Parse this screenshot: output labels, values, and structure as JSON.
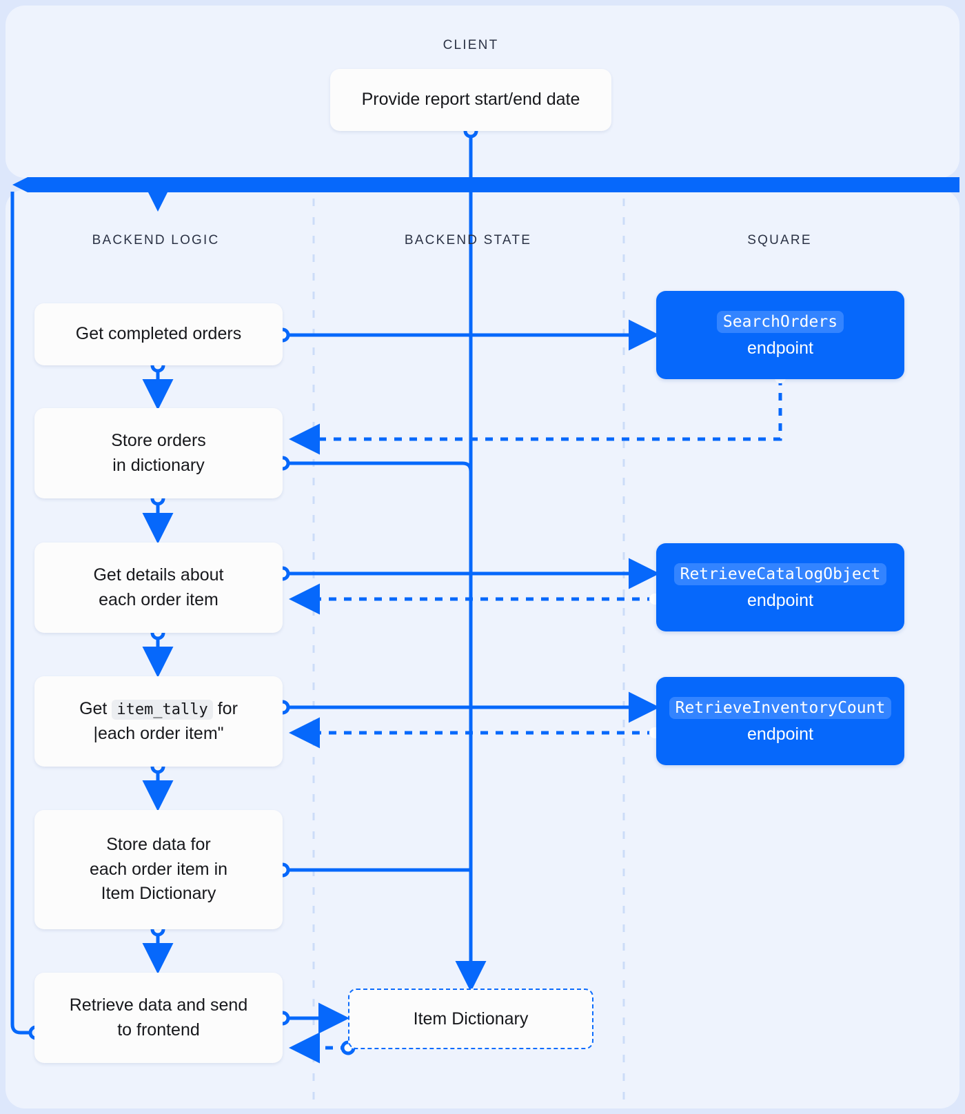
{
  "diagram": {
    "title": "Square order report backend sequence diagram",
    "colors": {
      "accent": "#0668fb",
      "accent_chip": "#3384ff",
      "panel_bg": "#eef3fd",
      "page_bg": "#dde7fb",
      "node_bg": "#fcfcfc",
      "band_dark": "#0668fb",
      "band_light": "#cddefb",
      "lane_divider": "#ccdcf8",
      "text": "#17181c",
      "lane_label": "#2b3245"
    },
    "lanes": [
      {
        "id": "client",
        "label": "CLIENT"
      },
      {
        "id": "backend-logic",
        "label": "BACKEND LOGIC"
      },
      {
        "id": "backend-state",
        "label": "BACKEND STATE"
      },
      {
        "id": "square",
        "label": "SQUARE"
      }
    ],
    "client_nodes": [
      {
        "id": "provide-dates",
        "label": "Provide report start/end date"
      }
    ],
    "backend_logic_nodes": [
      {
        "id": "get-completed-orders",
        "lines": [
          "Get completed orders"
        ]
      },
      {
        "id": "store-orders",
        "lines": [
          "Store orders",
          "in dictionary"
        ]
      },
      {
        "id": "get-item-details",
        "lines": [
          "Get details about",
          "each order item"
        ]
      },
      {
        "id": "get-item-tally",
        "lines": [
          "Get ",
          " for",
          "|each order item\""
        ],
        "prefix": "Get",
        "code": "item_tally",
        "suffix": "for",
        "line2": "|each order item\""
      },
      {
        "id": "store-item-data",
        "lines": [
          "Store data for",
          "each order item in",
          "Item Dictionary"
        ]
      },
      {
        "id": "retrieve-send",
        "lines": [
          "Retrieve data and send",
          "to frontend"
        ]
      }
    ],
    "backend_state_nodes": [
      {
        "id": "item-dictionary",
        "label": "Item Dictionary"
      }
    ],
    "square_nodes": [
      {
        "id": "search-orders",
        "code": "SearchOrders",
        "sub": "endpoint"
      },
      {
        "id": "retrieve-catalog-object",
        "code": "RetrieveCatalogObject",
        "sub": "endpoint"
      },
      {
        "id": "retrieve-inventory-count",
        "code": "RetrieveInventoryCount",
        "sub": "endpoint"
      }
    ]
  }
}
